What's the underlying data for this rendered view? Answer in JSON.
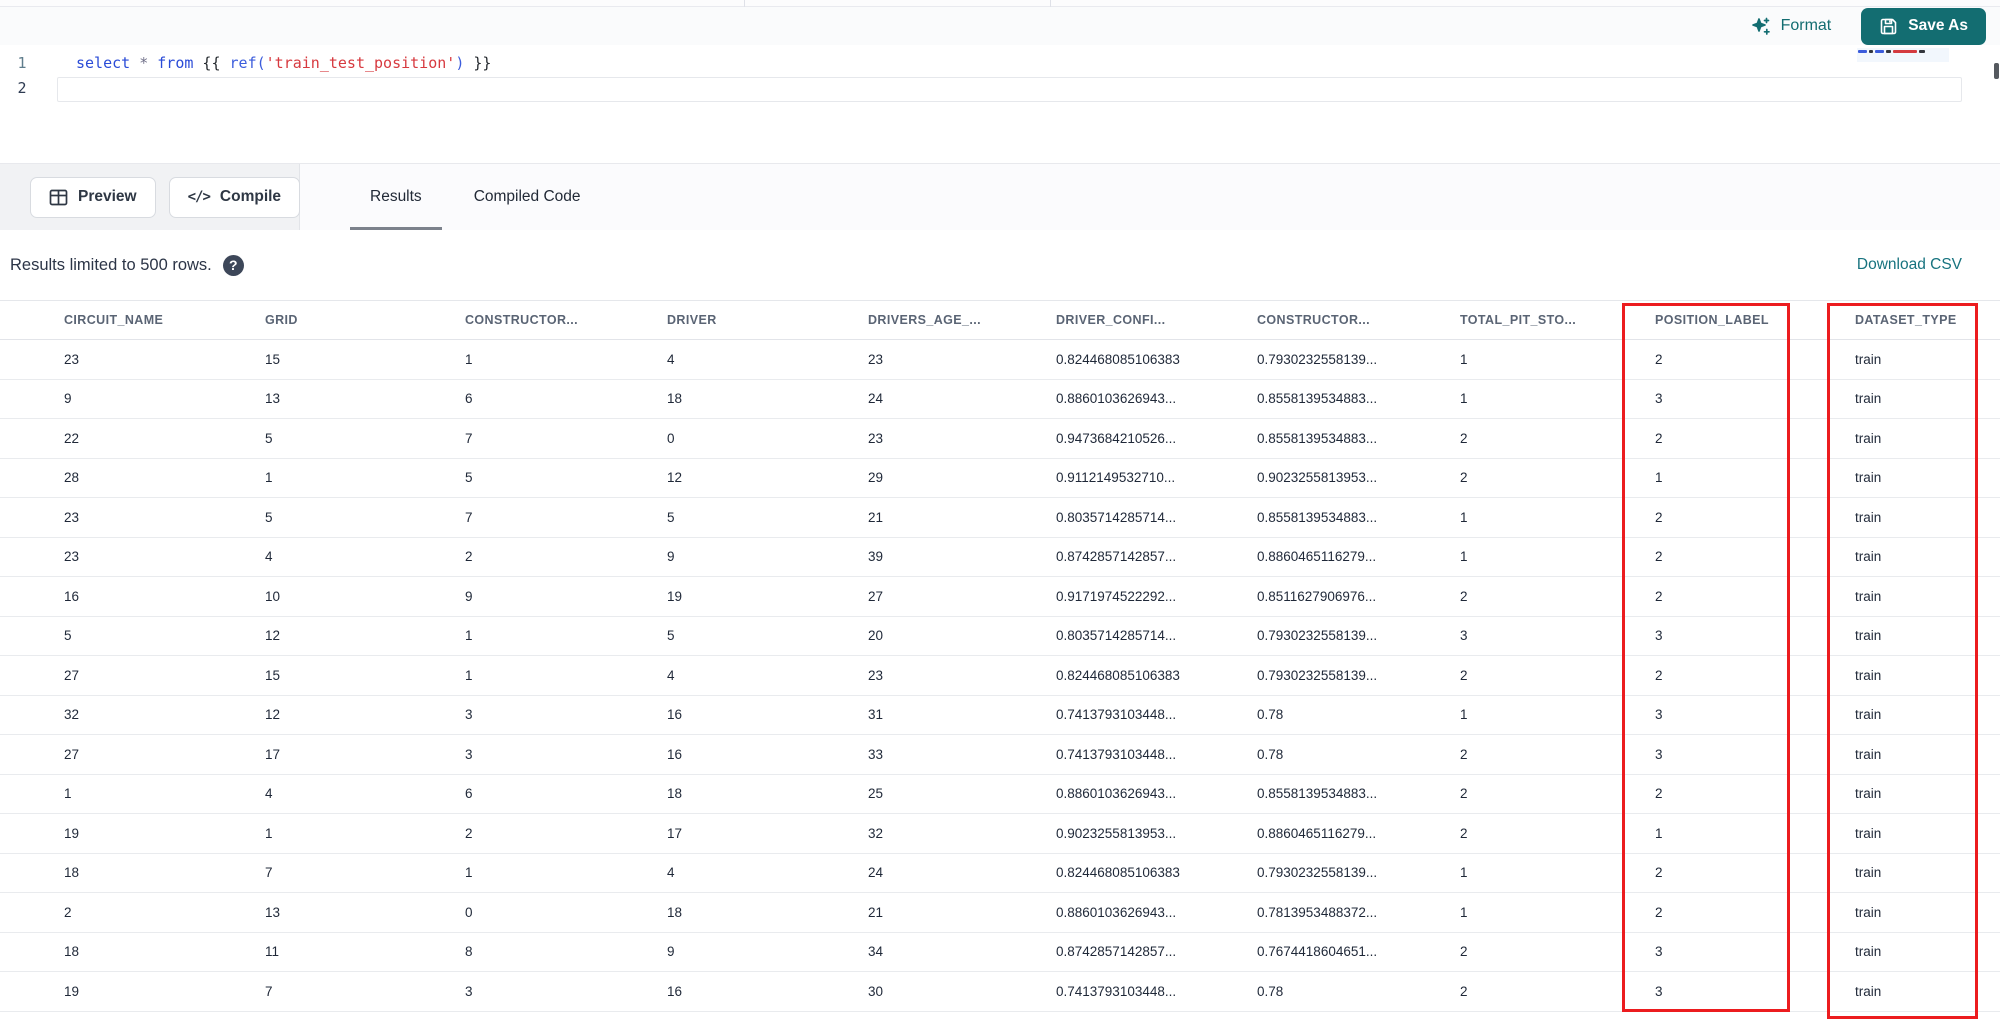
{
  "colors": {
    "accent_teal": "#136d71",
    "link_teal": "#17737f",
    "highlight_red": "#ec1c1f"
  },
  "toolbar": {
    "format_label": "Format",
    "save_as_label": "Save As"
  },
  "editor": {
    "line_numbers": [
      "1",
      "2"
    ],
    "tokens": [
      {
        "t": "select",
        "c": "kw"
      },
      {
        "t": " ",
        "c": "pl"
      },
      {
        "t": "*",
        "c": "op"
      },
      {
        "t": " ",
        "c": "pl"
      },
      {
        "t": "from",
        "c": "kw"
      },
      {
        "t": " {{ ",
        "c": "pl"
      },
      {
        "t": "ref(",
        "c": "fn"
      },
      {
        "t": "'train_test_position'",
        "c": "str"
      },
      {
        "t": ")",
        "c": "fn"
      },
      {
        "t": " }}",
        "c": "pl"
      }
    ]
  },
  "actions": {
    "preview_label": "Preview",
    "compile_label": "Compile"
  },
  "tabs": [
    {
      "label": "Results",
      "active": true
    },
    {
      "label": "Compiled Code",
      "active": false
    }
  ],
  "results_bar": {
    "info": "Results limited to 500 rows.",
    "download_label": "Download CSV"
  },
  "table": {
    "columns": [
      "CIRCUIT_NAME",
      "GRID",
      "CONSTRUCTOR...",
      "DRIVER",
      "DRIVERS_AGE_...",
      "DRIVER_CONFI...",
      "CONSTRUCTOR...",
      "TOTAL_PIT_STO...",
      "POSITION_LABEL",
      "DATASET_TYPE"
    ],
    "highlighted_columns": [
      "POSITION_LABEL",
      "DATASET_TYPE"
    ],
    "rows": [
      [
        "23",
        "15",
        "1",
        "4",
        "23",
        "0.824468085106383",
        "0.7930232558139...",
        "1",
        "2",
        "train"
      ],
      [
        "9",
        "13",
        "6",
        "18",
        "24",
        "0.8860103626943...",
        "0.8558139534883...",
        "1",
        "3",
        "train"
      ],
      [
        "22",
        "5",
        "7",
        "0",
        "23",
        "0.9473684210526...",
        "0.8558139534883...",
        "2",
        "2",
        "train"
      ],
      [
        "28",
        "1",
        "5",
        "12",
        "29",
        "0.9112149532710...",
        "0.9023255813953...",
        "2",
        "1",
        "train"
      ],
      [
        "23",
        "5",
        "7",
        "5",
        "21",
        "0.8035714285714...",
        "0.8558139534883...",
        "1",
        "2",
        "train"
      ],
      [
        "23",
        "4",
        "2",
        "9",
        "39",
        "0.8742857142857...",
        "0.8860465116279...",
        "1",
        "2",
        "train"
      ],
      [
        "16",
        "10",
        "9",
        "19",
        "27",
        "0.9171974522292...",
        "0.8511627906976...",
        "2",
        "2",
        "train"
      ],
      [
        "5",
        "12",
        "1",
        "5",
        "20",
        "0.8035714285714...",
        "0.7930232558139...",
        "3",
        "3",
        "train"
      ],
      [
        "27",
        "15",
        "1",
        "4",
        "23",
        "0.824468085106383",
        "0.7930232558139...",
        "2",
        "2",
        "train"
      ],
      [
        "32",
        "12",
        "3",
        "16",
        "31",
        "0.7413793103448...",
        "0.78",
        "1",
        "3",
        "train"
      ],
      [
        "27",
        "17",
        "3",
        "16",
        "33",
        "0.7413793103448...",
        "0.78",
        "2",
        "3",
        "train"
      ],
      [
        "1",
        "4",
        "6",
        "18",
        "25",
        "0.8860103626943...",
        "0.8558139534883...",
        "2",
        "2",
        "train"
      ],
      [
        "19",
        "1",
        "2",
        "17",
        "32",
        "0.9023255813953...",
        "0.8860465116279...",
        "2",
        "1",
        "train"
      ],
      [
        "18",
        "7",
        "1",
        "4",
        "24",
        "0.824468085106383",
        "0.7930232558139...",
        "1",
        "2",
        "train"
      ],
      [
        "2",
        "13",
        "0",
        "18",
        "21",
        "0.8860103626943...",
        "0.7813953488372...",
        "1",
        "2",
        "train"
      ],
      [
        "18",
        "11",
        "8",
        "9",
        "34",
        "0.8742857142857...",
        "0.7674418604651...",
        "2",
        "3",
        "train"
      ],
      [
        "19",
        "7",
        "3",
        "16",
        "30",
        "0.7413793103448...",
        "0.78",
        "2",
        "3",
        "train"
      ]
    ]
  }
}
